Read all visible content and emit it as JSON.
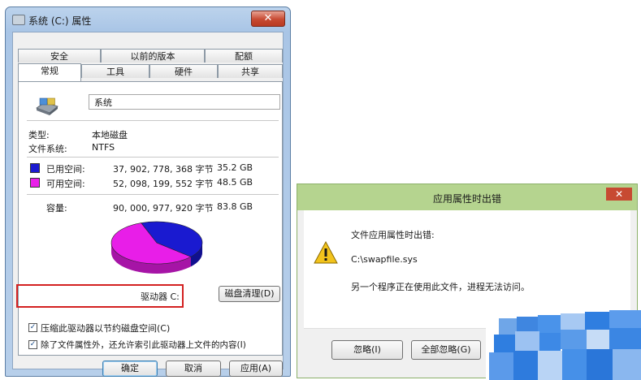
{
  "properties_window": {
    "title": "系统 (C:) 属性",
    "close_glyph": "✕",
    "tabs_row1": [
      "安全",
      "以前的版本",
      "配额"
    ],
    "tabs_row2": [
      "常规",
      "工具",
      "硬件",
      "共享"
    ],
    "active_tab": "常规",
    "drive_name_value": "系统",
    "type_label": "类型:",
    "type_value": "本地磁盘",
    "fs_label": "文件系统:",
    "fs_value": "NTFS",
    "used": {
      "label": "已用空间:",
      "bytes": "37, 902, 778, 368 字节",
      "size": "35.2 GB",
      "color": "#1a1ad0"
    },
    "free": {
      "label": "可用空间:",
      "bytes": "52, 098, 199, 552 字节",
      "size": "48.5 GB",
      "color": "#e81ee8"
    },
    "capacity": {
      "label": "容量:",
      "bytes": "90, 000, 977, 920 字节",
      "size": "83.8 GB"
    },
    "used_fraction": 0.421,
    "drive_label": "驱动器 C:",
    "cleanup_button": "磁盘清理(D)",
    "compress_checkbox": "压缩此驱动器以节约磁盘空间(C)",
    "compress_checked": true,
    "index_checkbox": "除了文件属性外，还允许索引此驱动器上文件的内容(I)",
    "index_checked": true,
    "ok_button": "确定",
    "cancel_button": "取消",
    "apply_button": "应用(A)",
    "check_glyph": "✓"
  },
  "error_dialog": {
    "title": "应用属性时出错",
    "close_glyph": "✕",
    "message_line1": "文件应用属性时出错:",
    "file_path": "C:\\swapfile.sys",
    "message_line2": "另一个程序正在使用此文件，进程无法访问。",
    "ignore_button": "忽略(I)",
    "ignore_all_button": "全部忽略(G)",
    "accent_color": "#b5d48f"
  }
}
